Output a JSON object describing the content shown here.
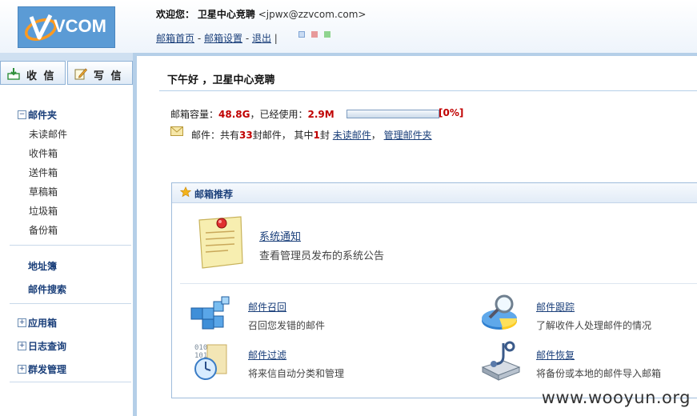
{
  "header": {
    "logo_text": "VCOM",
    "welcome_label": "欢迎您：",
    "user_name": "卫星中心竞聘",
    "user_email": "<jpwx@zzvcom.com>",
    "nav": {
      "home": "邮箱首页",
      "settings": "邮箱设置",
      "logout": "退出",
      "sep1": " - ",
      "sep2": " - ",
      "sep3": " | "
    },
    "theme_colors": [
      "#8fb3e0",
      "#e79a9a",
      "#8fd48f"
    ]
  },
  "sidebar": {
    "receive_label": "收 信",
    "compose_label": "写 信",
    "mailfolder_label": "邮件夹",
    "folders": [
      "未读邮件",
      "收件箱",
      "送件箱",
      "草稿箱",
      "垃圾箱",
      "备份箱"
    ],
    "address_book": "地址簿",
    "mail_search": "邮件搜索",
    "apps_label": "应用箱",
    "log_query": "日志查询",
    "group_mgmt": "群发管理",
    "expand_minus": "−",
    "expand_plus": "+"
  },
  "main": {
    "greeting": "下午好 ，卫星中心竞聘",
    "quota_label": "邮箱容量：",
    "quota_total": "48.8G",
    "used_label": "，已经使用：",
    "used_value": "2.9M",
    "used_percent_text": "[0%]",
    "used_fraction": 0.0,
    "mail_prefix": "邮件：共有",
    "mail_count": "33",
    "mail_mid": "封邮件， 其中",
    "unread_count": "1",
    "mail_suffix": "封",
    "unread_link": "未读邮件",
    "comma": "，",
    "manage_link": "管理邮件夹"
  },
  "recommend": {
    "title": "邮箱推荐",
    "notice_title": "系统通知",
    "notice_desc": "查看管理员发布的系统公告",
    "items": [
      {
        "title": "邮件召回",
        "desc": "召回您发错的邮件"
      },
      {
        "title": "邮件跟踪",
        "desc": "了解收件人处理邮件的情况"
      },
      {
        "title": "邮件过滤",
        "desc": "将来信自动分类和管理"
      },
      {
        "title": "邮件恢复",
        "desc": "将备份或本地的邮件导入邮箱"
      }
    ]
  },
  "watermark": "www.wooyun.org",
  "colors": {
    "accent_blue": "#1a3f7a",
    "highlight_red": "#c00000",
    "sidebar_border": "#b5cfe8"
  }
}
